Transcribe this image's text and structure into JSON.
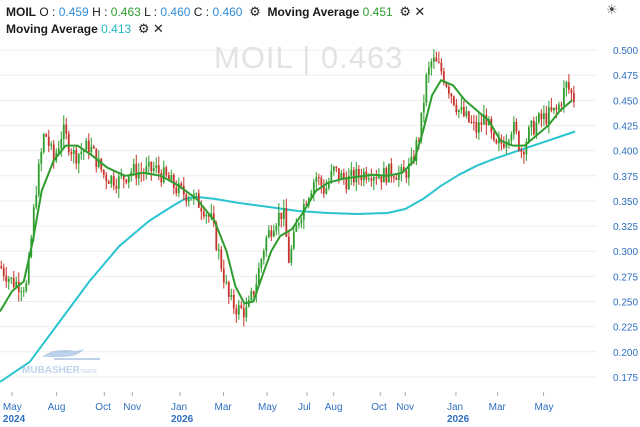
{
  "header": {
    "symbol": "MOIL",
    "open_label": "O :",
    "open": "0.459",
    "high_label": "H :",
    "high": "0.463",
    "low_label": "L :",
    "low": "0.460",
    "close_label": "C :",
    "close": "0.460",
    "ma1_name": "Moving Average",
    "ma1_value": "0.451",
    "ma2_name": "Moving Average",
    "ma2_value": "0.413"
  },
  "watermark": "MOIL | 0.463",
  "logo_text": "MUBASHER",
  "logo_sub": "TRADE",
  "colors": {
    "up": "#2e9d2e",
    "down": "#c8322a",
    "ma_fast": "#2e9d2e",
    "ma_slow": "#29c4cf",
    "axis_text": "#2e6fc0",
    "grid": "#eeeeee"
  },
  "chart_data": {
    "type": "candlestick",
    "title": "",
    "ylim": [
      0.16,
      0.51
    ],
    "y_ticks": [
      0.5,
      0.475,
      0.45,
      0.425,
      0.4,
      0.375,
      0.35,
      0.325,
      0.3,
      0.275,
      0.25,
      0.225,
      0.2,
      0.175
    ],
    "y_tick_labels": [
      "0.500",
      "0.475",
      "0.450",
      "0.425",
      "0.400",
      "0.375",
      "0.350",
      "0.325",
      "0.300",
      "0.275",
      "0.250",
      "0.225",
      "0.200",
      "0.175"
    ],
    "x_labels": [
      {
        "label": "May",
        "year": "2024",
        "t": 0.02
      },
      {
        "label": "Aug",
        "t": 0.095
      },
      {
        "label": "Oct",
        "t": 0.175
      },
      {
        "label": "Nov",
        "t": 0.222
      },
      {
        "label": "Jan",
        "year": "2026",
        "t": 0.302
      },
      {
        "label": "Mar",
        "t": 0.375
      },
      {
        "label": "May",
        "t": 0.448
      },
      {
        "label": "Jul",
        "t": 0.515
      },
      {
        "label": "Aug",
        "t": 0.56
      },
      {
        "label": "Oct",
        "t": 0.638
      },
      {
        "label": "Nov",
        "t": 0.68
      },
      {
        "label": "Jan",
        "year": "2026",
        "t": 0.765
      },
      {
        "label": "Mar",
        "t": 0.835
      },
      {
        "label": "May",
        "t": 0.912
      }
    ],
    "price_path": [
      [
        0.0,
        0.285
      ],
      [
        0.02,
        0.27
      ],
      [
        0.045,
        0.265
      ],
      [
        0.06,
        0.36
      ],
      [
        0.075,
        0.42
      ],
      [
        0.09,
        0.39
      ],
      [
        0.105,
        0.42
      ],
      [
        0.125,
        0.395
      ],
      [
        0.15,
        0.405
      ],
      [
        0.175,
        0.375
      ],
      [
        0.2,
        0.37
      ],
      [
        0.22,
        0.38
      ],
      [
        0.24,
        0.378
      ],
      [
        0.26,
        0.382
      ],
      [
        0.28,
        0.372
      ],
      [
        0.3,
        0.36
      ],
      [
        0.32,
        0.355
      ],
      [
        0.34,
        0.345
      ],
      [
        0.355,
        0.33
      ],
      [
        0.37,
        0.29
      ],
      [
        0.385,
        0.25
      ],
      [
        0.4,
        0.242
      ],
      [
        0.415,
        0.24
      ],
      [
        0.43,
        0.27
      ],
      [
        0.445,
        0.31
      ],
      [
        0.46,
        0.33
      ],
      [
        0.475,
        0.34
      ],
      [
        0.485,
        0.29
      ],
      [
        0.5,
        0.33
      ],
      [
        0.515,
        0.355
      ],
      [
        0.53,
        0.375
      ],
      [
        0.545,
        0.36
      ],
      [
        0.56,
        0.38
      ],
      [
        0.58,
        0.37
      ],
      [
        0.6,
        0.375
      ],
      [
        0.62,
        0.38
      ],
      [
        0.64,
        0.375
      ],
      [
        0.66,
        0.38
      ],
      [
        0.675,
        0.375
      ],
      [
        0.69,
        0.385
      ],
      [
        0.705,
        0.42
      ],
      [
        0.715,
        0.47
      ],
      [
        0.725,
        0.49
      ],
      [
        0.74,
        0.48
      ],
      [
        0.755,
        0.46
      ],
      [
        0.77,
        0.44
      ],
      [
        0.785,
        0.43
      ],
      [
        0.8,
        0.42
      ],
      [
        0.815,
        0.435
      ],
      [
        0.83,
        0.4
      ],
      [
        0.845,
        0.41
      ],
      [
        0.86,
        0.425
      ],
      [
        0.875,
        0.4
      ],
      [
        0.89,
        0.42
      ],
      [
        0.905,
        0.43
      ],
      [
        0.92,
        0.435
      ],
      [
        0.935,
        0.44
      ],
      [
        0.95,
        0.465
      ],
      [
        0.965,
        0.45
      ]
    ],
    "series": [
      {
        "type": "line",
        "points": [
          [
            0.0,
            0.24
          ],
          [
            0.02,
            0.26
          ],
          [
            0.04,
            0.27
          ],
          [
            0.055,
            0.31
          ],
          [
            0.07,
            0.36
          ],
          [
            0.09,
            0.39
          ],
          [
            0.11,
            0.405
          ],
          [
            0.13,
            0.405
          ],
          [
            0.155,
            0.395
          ],
          [
            0.18,
            0.383
          ],
          [
            0.21,
            0.375
          ],
          [
            0.24,
            0.378
          ],
          [
            0.27,
            0.375
          ],
          [
            0.3,
            0.365
          ],
          [
            0.33,
            0.352
          ],
          [
            0.36,
            0.33
          ],
          [
            0.38,
            0.3
          ],
          [
            0.395,
            0.265
          ],
          [
            0.41,
            0.248
          ],
          [
            0.425,
            0.25
          ],
          [
            0.44,
            0.275
          ],
          [
            0.455,
            0.3
          ],
          [
            0.47,
            0.315
          ],
          [
            0.49,
            0.322
          ],
          [
            0.51,
            0.34
          ],
          [
            0.53,
            0.36
          ],
          [
            0.55,
            0.368
          ],
          [
            0.575,
            0.372
          ],
          [
            0.6,
            0.374
          ],
          [
            0.625,
            0.376
          ],
          [
            0.65,
            0.375
          ],
          [
            0.675,
            0.378
          ],
          [
            0.695,
            0.39
          ],
          [
            0.71,
            0.42
          ],
          [
            0.725,
            0.455
          ],
          [
            0.74,
            0.47
          ],
          [
            0.76,
            0.465
          ],
          [
            0.78,
            0.45
          ],
          [
            0.8,
            0.44
          ],
          [
            0.82,
            0.43
          ],
          [
            0.84,
            0.41
          ],
          [
            0.86,
            0.405
          ],
          [
            0.88,
            0.405
          ],
          [
            0.9,
            0.415
          ],
          [
            0.92,
            0.425
          ],
          [
            0.94,
            0.44
          ],
          [
            0.96,
            0.45
          ]
        ]
      },
      {
        "type": "line",
        "points": [
          [
            0.0,
            0.17
          ],
          [
            0.05,
            0.19
          ],
          [
            0.1,
            0.23
          ],
          [
            0.15,
            0.27
          ],
          [
            0.2,
            0.305
          ],
          [
            0.25,
            0.33
          ],
          [
            0.29,
            0.345
          ],
          [
            0.31,
            0.352
          ],
          [
            0.33,
            0.354
          ],
          [
            0.36,
            0.352
          ],
          [
            0.4,
            0.348
          ],
          [
            0.45,
            0.344
          ],
          [
            0.5,
            0.34
          ],
          [
            0.55,
            0.338
          ],
          [
            0.6,
            0.337
          ],
          [
            0.65,
            0.338
          ],
          [
            0.68,
            0.342
          ],
          [
            0.71,
            0.352
          ],
          [
            0.74,
            0.365
          ],
          [
            0.77,
            0.376
          ],
          [
            0.8,
            0.385
          ],
          [
            0.83,
            0.392
          ],
          [
            0.86,
            0.398
          ],
          [
            0.89,
            0.404
          ],
          [
            0.92,
            0.41
          ],
          [
            0.95,
            0.416
          ],
          [
            0.965,
            0.419
          ]
        ]
      }
    ]
  }
}
